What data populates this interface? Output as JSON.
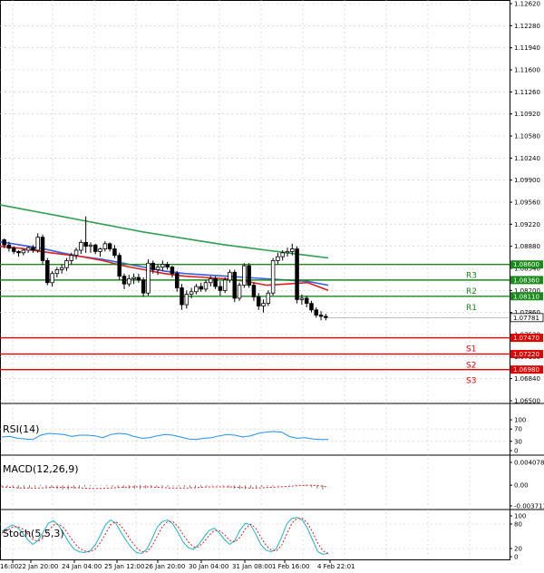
{
  "chart_data": {
    "type": "candlestick",
    "price_axis": {
      "ticks": [
        "1.12620",
        "1.12280",
        "1.11940",
        "1.11600",
        "1.11260",
        "1.10920",
        "1.10580",
        "1.10240",
        "1.09900",
        "1.09560",
        "1.09220",
        "1.08880",
        "1.08540",
        "1.08200",
        "1.07860",
        "1.07520",
        "1.07180",
        "1.06840",
        "1.06500"
      ],
      "range": [
        1.065,
        1.1262
      ]
    },
    "time_axis": {
      "labels": [
        "16:00",
        "22 Jan 20:00",
        "24 Jan 04:00",
        "25 Jan 12:00",
        "26 Jan 20:00",
        "30 Jan 04:00",
        "31 Jan 08:00",
        "1 Feb 16:00",
        "4 Feb 22:01"
      ]
    },
    "candles": [
      [
        1.0898,
        1.09,
        1.0885,
        1.089
      ],
      [
        1.089,
        1.0895,
        1.088,
        1.0885
      ],
      [
        1.0885,
        1.0888,
        1.0876,
        1.088
      ],
      [
        1.088,
        1.0882,
        1.0872,
        1.0878
      ],
      [
        1.0878,
        1.0884,
        1.0874,
        1.0882
      ],
      [
        1.0882,
        1.0888,
        1.0878,
        1.0886
      ],
      [
        1.0886,
        1.089,
        1.0878,
        1.0882
      ],
      [
        1.0882,
        1.0908,
        1.0878,
        1.0902
      ],
      [
        1.0902,
        1.0906,
        1.086,
        1.0866
      ],
      [
        1.0866,
        1.087,
        1.0828,
        1.0832
      ],
      [
        1.0832,
        1.085,
        1.0826,
        1.0846
      ],
      [
        1.0846,
        1.0856,
        1.084,
        1.0852
      ],
      [
        1.0852,
        1.086,
        1.0846,
        1.0855
      ],
      [
        1.0855,
        1.087,
        1.085,
        1.0866
      ],
      [
        1.0866,
        1.0878,
        1.086,
        1.0874
      ],
      [
        1.0874,
        1.0886,
        1.0868,
        1.0882
      ],
      [
        1.0882,
        1.0898,
        1.0876,
        1.0894
      ],
      [
        1.0894,
        1.0934,
        1.0878,
        1.0888
      ],
      [
        1.0888,
        1.0894,
        1.0878,
        1.089
      ],
      [
        1.089,
        1.0892,
        1.0876,
        1.088
      ],
      [
        1.088,
        1.0886,
        1.0872,
        1.0884
      ],
      [
        1.0884,
        1.0896,
        1.088,
        1.0892
      ],
      [
        1.0892,
        1.0894,
        1.088,
        1.0884
      ],
      [
        1.0884,
        1.089,
        1.087,
        1.0874
      ],
      [
        1.0874,
        1.0878,
        1.0836,
        1.0842
      ],
      [
        1.0842,
        1.0846,
        1.0822,
        1.083
      ],
      [
        1.083,
        1.0844,
        1.0826,
        1.0838
      ],
      [
        1.0838,
        1.0846,
        1.083,
        1.084
      ],
      [
        1.084,
        1.0846,
        1.0832,
        1.0836
      ],
      [
        1.0836,
        1.084,
        1.081,
        1.0816
      ],
      [
        1.0816,
        1.0868,
        1.0812,
        1.0862
      ],
      [
        1.0862,
        1.0866,
        1.0846,
        1.0852
      ],
      [
        1.0852,
        1.086,
        1.0844,
        1.0856
      ],
      [
        1.0856,
        1.0866,
        1.085,
        1.086
      ],
      [
        1.086,
        1.0864,
        1.0852,
        1.0856
      ],
      [
        1.0856,
        1.0858,
        1.084,
        1.0846
      ],
      [
        1.0846,
        1.085,
        1.0818,
        1.0824
      ],
      [
        1.0824,
        1.083,
        1.079,
        1.0798
      ],
      [
        1.0798,
        1.082,
        1.0792,
        1.0814
      ],
      [
        1.0814,
        1.0824,
        1.0808,
        1.0818
      ],
      [
        1.0818,
        1.083,
        1.0814,
        1.0826
      ],
      [
        1.0826,
        1.0832,
        1.0818,
        1.0822
      ],
      [
        1.0822,
        1.0836,
        1.0818,
        1.0832
      ],
      [
        1.0832,
        1.0842,
        1.0826,
        1.0838
      ],
      [
        1.0838,
        1.0842,
        1.0822,
        1.0826
      ],
      [
        1.0826,
        1.0834,
        1.0812,
        1.082
      ],
      [
        1.082,
        1.084,
        1.0816,
        1.0836
      ],
      [
        1.0836,
        1.0852,
        1.0832,
        1.0848
      ],
      [
        1.0848,
        1.0852,
        1.0802,
        1.0808
      ],
      [
        1.0808,
        1.0832,
        1.0804,
        1.0828
      ],
      [
        1.0828,
        1.0862,
        1.0824,
        1.0858
      ],
      [
        1.0858,
        1.0862,
        1.0824,
        1.0828
      ],
      [
        1.0828,
        1.0832,
        1.0804,
        1.081
      ],
      [
        1.081,
        1.0816,
        1.079,
        1.0796
      ],
      [
        1.0796,
        1.0806,
        1.0786,
        1.08
      ],
      [
        1.08,
        1.082,
        1.0796,
        1.0816
      ],
      [
        1.0816,
        1.087,
        1.0812,
        1.0866
      ],
      [
        1.0866,
        1.0878,
        1.086,
        1.0872
      ],
      [
        1.0872,
        1.0882,
        1.0866,
        1.0878
      ],
      [
        1.0878,
        1.0886,
        1.0872,
        1.088
      ],
      [
        1.088,
        1.0892,
        1.0874,
        1.0884
      ],
      [
        1.0884,
        1.0888,
        1.08,
        1.0806
      ],
      [
        1.0806,
        1.0814,
        1.0798,
        1.0808
      ],
      [
        1.0808,
        1.0812,
        1.0794,
        1.08
      ],
      [
        1.08,
        1.0804,
        1.0786,
        1.079
      ],
      [
        1.079,
        1.0794,
        1.0778,
        1.0782
      ],
      [
        1.0782,
        1.0788,
        1.0774,
        1.078
      ],
      [
        1.078,
        1.0784,
        1.0774,
        1.07781
      ]
    ],
    "moving_averages": [
      {
        "color": "#2e9e4f",
        "values": [
          1.0952,
          1.0946,
          1.094,
          1.0934,
          1.0928,
          1.0922,
          1.0916,
          1.091,
          1.0905,
          1.09,
          1.0895,
          1.089,
          1.0886,
          1.0882,
          1.0878,
          1.0874,
          1.087
        ]
      },
      {
        "color": "#3a5ee0",
        "values": [
          1.0895,
          1.089,
          1.0885,
          1.0878,
          1.0872,
          1.0868,
          1.0862,
          1.0856,
          1.085,
          1.0846,
          1.0844,
          1.0842,
          1.084,
          1.0838,
          1.0836,
          1.0834,
          1.0828
        ]
      },
      {
        "color": "#e02020",
        "values": [
          1.0888,
          1.0885,
          1.088,
          1.0876,
          1.0872,
          1.0866,
          1.0858,
          1.0852,
          1.0846,
          1.0842,
          1.084,
          1.0838,
          1.0834,
          1.0828,
          1.083,
          1.0832,
          1.082
        ]
      }
    ],
    "levels": [
      {
        "name": "R3",
        "tag": "1.08600",
        "value": 1.086,
        "color": "#1a8a1a"
      },
      {
        "name": "R2",
        "tag": "1.08360",
        "value": 1.0836,
        "color": "#1a8a1a"
      },
      {
        "name": "R1",
        "tag": "1.08110",
        "value": 1.0811,
        "color": "#1a8a1a"
      },
      {
        "name": "S1",
        "tag": "1.07470",
        "value": 1.0747,
        "color": "#e00000"
      },
      {
        "name": "S2",
        "tag": "1.07220",
        "value": 1.0722,
        "color": "#e00000"
      },
      {
        "name": "S3",
        "tag": "1.06980",
        "value": 1.0698,
        "color": "#e00000"
      }
    ],
    "current_price": {
      "value": 1.07781,
      "tag": "1.07781"
    },
    "rsi": {
      "title": "RSI(14)",
      "ticks": [
        "100",
        "70",
        "30",
        "0"
      ],
      "range": [
        0,
        100
      ],
      "values": [
        44,
        46,
        40,
        38,
        36,
        50,
        56,
        54,
        52,
        46,
        50,
        50,
        48,
        42,
        52,
        56,
        54,
        46,
        40,
        42,
        48,
        52,
        50,
        44,
        38,
        36,
        40,
        42,
        48,
        52,
        50,
        44,
        48,
        56,
        60,
        62,
        60,
        46,
        40,
        42,
        38,
        36,
        36
      ]
    },
    "macd": {
      "title": "MACD(12,26,9)",
      "ticks": [
        "0.004078",
        "0.00",
        "-0.003711"
      ],
      "range": [
        -0.003711,
        0.004078
      ],
      "histogram": [
        -0.0002,
        -0.0003,
        -0.0005,
        -0.0006,
        -0.0006,
        -0.0005,
        -0.0003,
        -0.0002,
        -0.0003,
        -0.0005,
        -0.0007,
        -0.0008,
        -0.0008,
        -0.0006,
        -0.0004,
        -0.0003,
        -0.0002,
        -0.0001,
        -0.0001,
        -0.0002,
        -0.0003,
        -0.0004,
        -0.0005,
        -0.0006,
        -0.0007,
        -0.0007,
        -0.0006,
        -0.0005,
        -0.0004,
        -0.0003,
        -0.0003,
        -0.0002,
        -0.0002,
        -0.0003,
        -0.0004,
        -0.0004,
        -0.0003,
        -0.0002,
        -0.0001,
        -0.0001,
        -0.0002,
        -0.0004,
        -0.0006,
        -0.0007,
        -0.0007,
        -0.0005,
        -0.0004,
        -0.0003,
        -0.0002,
        -0.0002,
        -0.0001,
        0.0,
        0.0001,
        0.0001,
        0.0,
        -0.0002,
        -0.0004,
        -0.0006,
        -0.0008
      ],
      "signal": [
        -0.0003,
        -0.0004,
        -0.0005,
        -0.0005,
        -0.0005,
        -0.0004,
        -0.0004,
        -0.0004,
        -0.0005,
        -0.0006,
        -0.0006,
        -0.0005,
        -0.0004,
        -0.0003,
        -0.0003,
        -0.0003,
        -0.0004,
        -0.0005,
        -0.0005,
        -0.0005,
        -0.0004,
        -0.0003,
        -0.0003,
        -0.0003,
        -0.0004,
        -0.0005,
        -0.0005,
        -0.0004,
        -0.0003,
        -0.0002,
        -0.0001,
        0.0,
        -0.0001,
        -0.0003
      ]
    },
    "stochastic": {
      "title": "Stoch(5,5,3)",
      "ticks": [
        "100",
        "80",
        "20",
        "0"
      ],
      "range": [
        0,
        100
      ],
      "k": [
        62,
        70,
        78,
        72,
        58,
        42,
        30,
        40,
        60,
        82,
        88,
        76,
        56,
        34,
        18,
        12,
        10,
        14,
        28,
        52,
        78,
        90,
        82,
        60,
        40,
        22,
        10,
        8,
        18,
        44,
        72,
        86,
        90,
        80,
        60,
        36,
        22,
        18,
        30,
        48,
        64,
        70,
        58,
        42,
        30,
        40,
        66,
        82,
        78,
        56,
        30,
        16,
        12,
        20,
        48,
        80,
        94,
        96,
        90,
        70,
        40,
        12,
        6,
        8
      ],
      "d": [
        58,
        64,
        72,
        74,
        68,
        56,
        42,
        38,
        46,
        64,
        78,
        80,
        70,
        52,
        34,
        20,
        14,
        12,
        18,
        34,
        56,
        78,
        86,
        76,
        58,
        38,
        22,
        12,
        12,
        26,
        50,
        74,
        86,
        86,
        74,
        54,
        36,
        24,
        24,
        36,
        52,
        64,
        64,
        54,
        40,
        36,
        48,
        68,
        80,
        70,
        48,
        28,
        16,
        14,
        28,
        56,
        82,
        94,
        94,
        82,
        60,
        32,
        14,
        8
      ]
    }
  }
}
